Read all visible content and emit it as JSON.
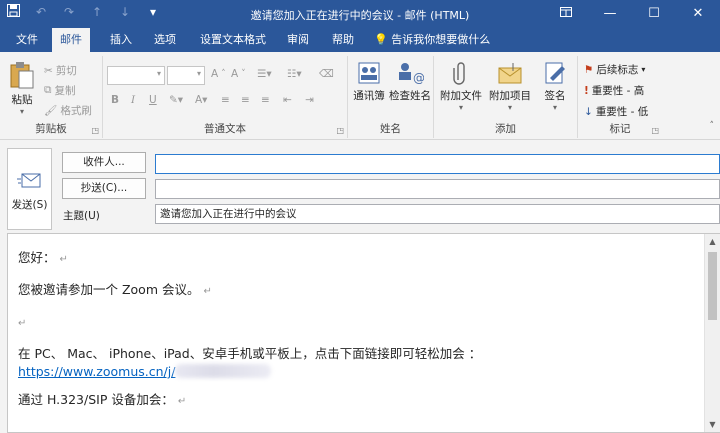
{
  "window": {
    "title": "邀请您加入正在进行中的会议  -  邮件 (HTML)",
    "qat": [
      "save-icon",
      "undo-icon",
      "redo-icon",
      "up-arrow-icon",
      "down-arrow-icon",
      "customize-icon"
    ],
    "controls": [
      "ribbon-display-icon",
      "minimize-icon",
      "maximize-icon",
      "close-icon"
    ]
  },
  "tabs": [
    {
      "label": "文件",
      "active": false
    },
    {
      "label": "邮件",
      "active": true
    },
    {
      "label": "插入",
      "active": false
    },
    {
      "label": "选项",
      "active": false
    },
    {
      "label": "设置文本格式",
      "active": false
    },
    {
      "label": "审阅",
      "active": false
    },
    {
      "label": "帮助",
      "active": false
    }
  ],
  "tell_me": "告诉我你想要做什么",
  "ribbon": {
    "clipboard": {
      "label": "剪贴板",
      "paste": "粘贴",
      "cut": "剪切",
      "copy": "复制",
      "format_painter": "格式刷"
    },
    "basic_text": {
      "label": "普通文本"
    },
    "names": {
      "label": "姓名",
      "address_book": "通讯簿",
      "check_names": "检查姓名"
    },
    "include": {
      "label": "添加",
      "attach_file": "附加文件",
      "attach_item": "附加项目",
      "signature": "签名"
    },
    "tags": {
      "label": "标记",
      "follow_up": "后续标志",
      "high_importance": "重要性 - 高",
      "low_importance": "重要性 - 低"
    }
  },
  "compose": {
    "send": "发送(S)",
    "to_button": "收件人...",
    "cc_button": "抄送(C)...",
    "to_value": "",
    "cc_value": "",
    "subject_label": "主题(U)",
    "subject_value": "邀请您加入正在进行中的会议"
  },
  "body": {
    "greeting": "您好：",
    "invite": "您被邀请参加一个 Zoom 会议。",
    "join_text": "在 PC、 Mac、 iPhone、iPad、安卓手机或平板上，点击下面链接即可轻松加会 ：",
    "link": "https://www.zoomus.cn/j/",
    "h323": "通过 H.323/SIP 设备加会："
  }
}
